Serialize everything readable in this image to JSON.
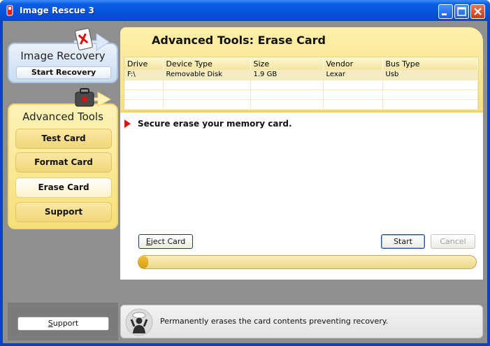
{
  "window": {
    "title": "Image Rescue 3",
    "icons": {
      "app": "app-icon",
      "minimize": "minimize-icon",
      "maximize": "maximize-icon",
      "close": "close-icon"
    }
  },
  "nav": {
    "recovery": {
      "title": "Image Recovery",
      "button": "Start Recovery",
      "icon": "card-x-icon"
    },
    "tools": {
      "title": "Advanced Tools",
      "icon": "toolbox-icon",
      "items": [
        "Test Card",
        "Format Card",
        "Erase Card",
        "Support"
      ],
      "active": "Erase Card"
    }
  },
  "main": {
    "title": "Advanced Tools: Erase Card",
    "columns": [
      "Drive",
      "Device Type",
      "Size",
      "Vendor",
      "Bus Type"
    ],
    "rows": [
      [
        "F:\\",
        "Removable Disk",
        "1.9 GB",
        "Lexar",
        "Usb"
      ]
    ],
    "instruction": "Secure erase your memory card.",
    "buttons": {
      "eject": "Eject Card",
      "start": "Start",
      "cancel": "Cancel"
    },
    "progress": 0.03
  },
  "statusbar": {
    "support": "Support",
    "message": "Permanently erases the card contents preventing recovery.",
    "icon": "helper-person-icon"
  },
  "colors": {
    "accent_yellow": "#f8e083",
    "nav_blue": "#c9dcf0",
    "alert_red": "#dd1111",
    "titlebar_blue": "#0552d8"
  }
}
